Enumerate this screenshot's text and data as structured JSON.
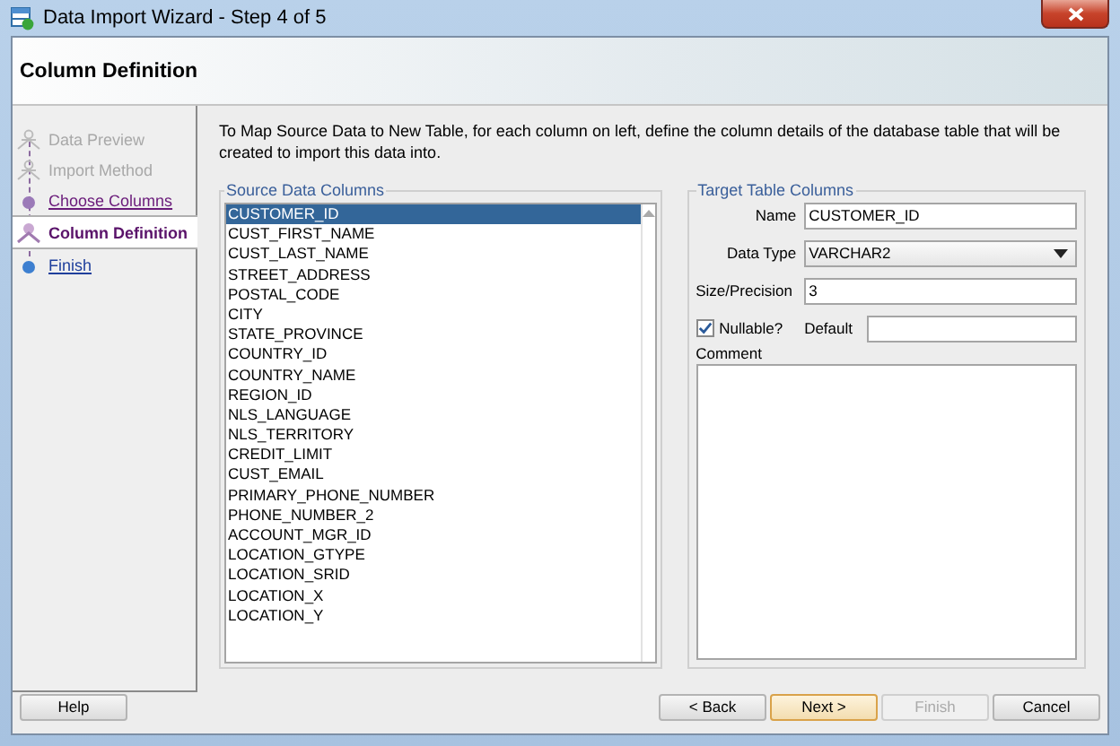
{
  "window": {
    "title": "Data Import Wizard - Step 4 of 5"
  },
  "header": {
    "title": "Column Definition"
  },
  "steps": [
    {
      "label": "Data Preview",
      "kind": "disabled",
      "selected": false
    },
    {
      "label": "Import Method",
      "kind": "disabled",
      "selected": false
    },
    {
      "label": "Choose Columns",
      "kind": "visited",
      "selected": false
    },
    {
      "label": "Column Definition",
      "kind": "current",
      "selected": true
    },
    {
      "label": "Finish",
      "kind": "link",
      "selected": false
    }
  ],
  "instructions": "To Map Source Data to New Table, for each column on left, define the column details of the database table that will be created to import this data into.",
  "source": {
    "title": "Source Data Columns",
    "items": [
      {
        "label": "CUSTOMER_ID",
        "selected": true
      },
      {
        "label": "CUST_FIRST_NAME",
        "selected": false
      },
      {
        "label": "CUST_LAST_NAME",
        "selected": false
      },
      {
        "label": "STREET_ADDRESS",
        "selected": false
      },
      {
        "label": "POSTAL_CODE",
        "selected": false
      },
      {
        "label": "CITY",
        "selected": false
      },
      {
        "label": "STATE_PROVINCE",
        "selected": false
      },
      {
        "label": "COUNTRY_ID",
        "selected": false
      },
      {
        "label": "COUNTRY_NAME",
        "selected": false
      },
      {
        "label": "REGION_ID",
        "selected": false
      },
      {
        "label": "NLS_LANGUAGE",
        "selected": false
      },
      {
        "label": "NLS_TERRITORY",
        "selected": false
      },
      {
        "label": "CREDIT_LIMIT",
        "selected": false
      },
      {
        "label": "CUST_EMAIL",
        "selected": false
      },
      {
        "label": "PRIMARY_PHONE_NUMBER",
        "selected": false
      },
      {
        "label": "PHONE_NUMBER_2",
        "selected": false
      },
      {
        "label": "ACCOUNT_MGR_ID",
        "selected": false
      },
      {
        "label": "LOCATION_GTYPE",
        "selected": false
      },
      {
        "label": "LOCATION_SRID",
        "selected": false
      },
      {
        "label": "LOCATION_X",
        "selected": false
      },
      {
        "label": "LOCATION_Y",
        "selected": false
      }
    ]
  },
  "target": {
    "title": "Target Table Columns",
    "name_label": "Name",
    "name": "CUSTOMER_ID",
    "type_label": "Data Type",
    "type": "VARCHAR2",
    "size_label": "Size/Precision",
    "size": "3",
    "nullable_label": "Nullable?",
    "nullable": true,
    "default_label": "Default",
    "comment_label": "Comment"
  },
  "buttons": [
    {
      "label": "Help",
      "kind": "help",
      "disabled": false,
      "focused": false
    },
    {
      "label": "< Back",
      "kind": "nav",
      "disabled": false,
      "focused": false
    },
    {
      "label": "Next >",
      "kind": "nav",
      "disabled": false,
      "focused": true
    },
    {
      "label": "Finish",
      "kind": "nav",
      "disabled": true,
      "focused": false
    },
    {
      "label": "Cancel",
      "kind": "nav",
      "disabled": false,
      "focused": false
    }
  ]
}
